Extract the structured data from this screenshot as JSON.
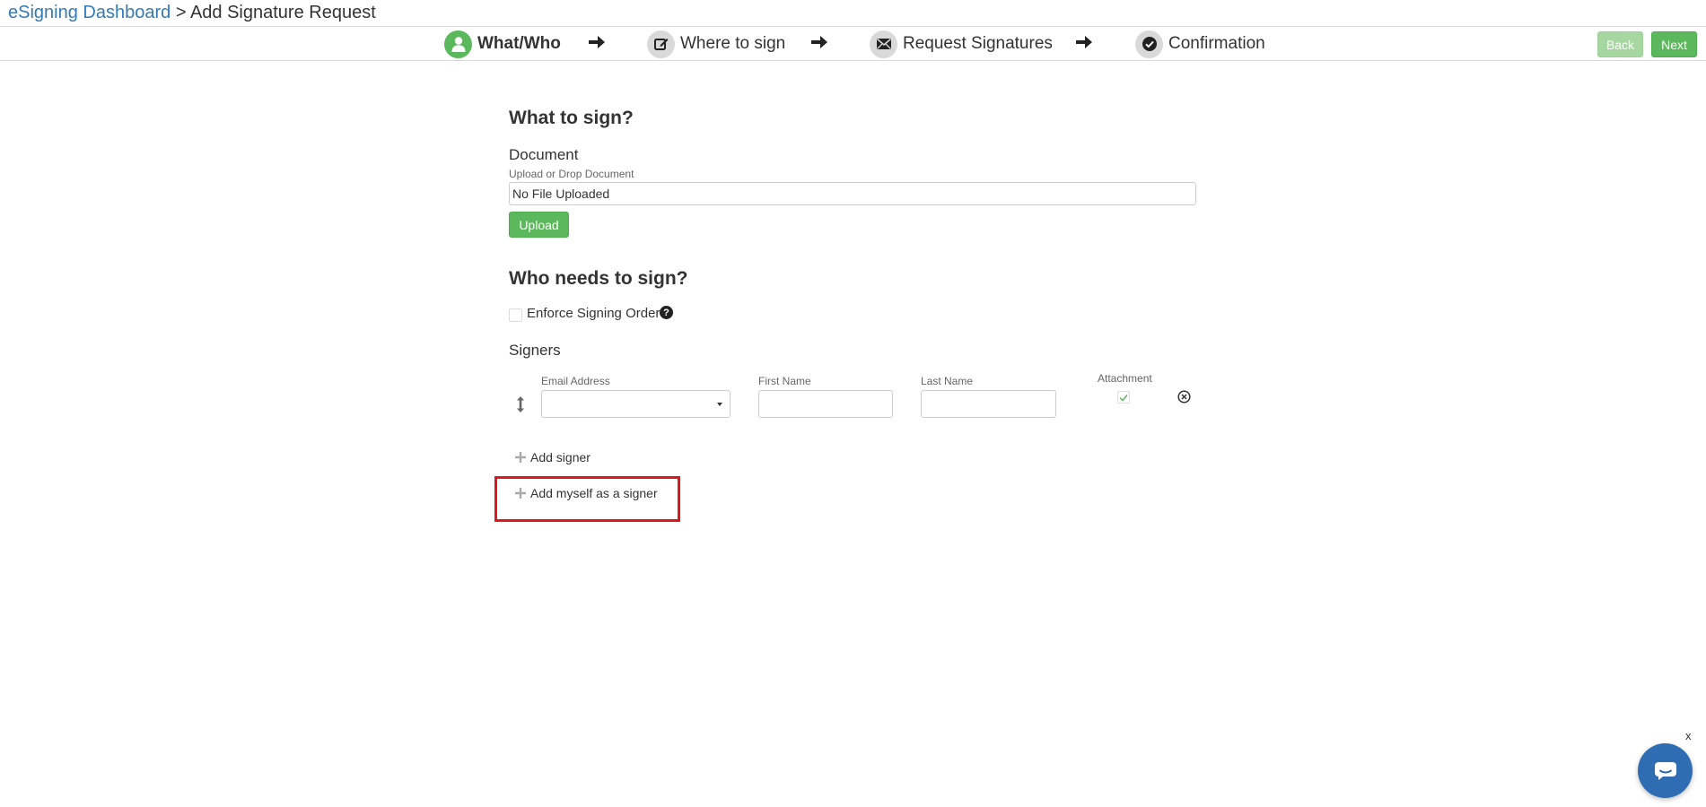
{
  "breadcrumb": {
    "root_label": "eSigning Dashboard",
    "separator": ">",
    "current_label": "Add Signature Request"
  },
  "wizard": {
    "steps": [
      {
        "label": "What/Who",
        "icon": "user-icon",
        "active": true
      },
      {
        "label": "Where to sign",
        "icon": "edit-icon",
        "active": false
      },
      {
        "label": "Request Signatures",
        "icon": "envelope-icon",
        "active": false
      },
      {
        "label": "Confirmation",
        "icon": "check-circle-icon",
        "active": false
      }
    ],
    "separator_icon": "arrow-right-icon",
    "back_label": "Back",
    "next_label": "Next"
  },
  "what_section": {
    "heading": "What to sign?",
    "document_label": "Document",
    "upload_hint": "Upload or Drop Document",
    "file_status": "No File Uploaded",
    "upload_button": "Upload"
  },
  "who_section": {
    "heading": "Who needs to sign?",
    "enforce_order_label": "Enforce Signing Order",
    "enforce_order_checked": false,
    "signers_label": "Signers",
    "columns": {
      "email": "Email Address",
      "first_name": "First Name",
      "last_name": "Last Name",
      "attachment": "Attachment"
    },
    "signer_row": {
      "email": "",
      "first_name": "",
      "last_name": "",
      "attachment_checked": true
    },
    "add_signer_label": "Add signer",
    "add_myself_label": "Add myself as a signer"
  },
  "chat": {
    "close_label": "x",
    "icon": "chat-bubble-icon"
  },
  "colors": {
    "accent_green": "#5cb85c",
    "link_blue": "#337ab7",
    "highlight_red": "#e0161c",
    "chat_blue": "#2f6db3"
  }
}
